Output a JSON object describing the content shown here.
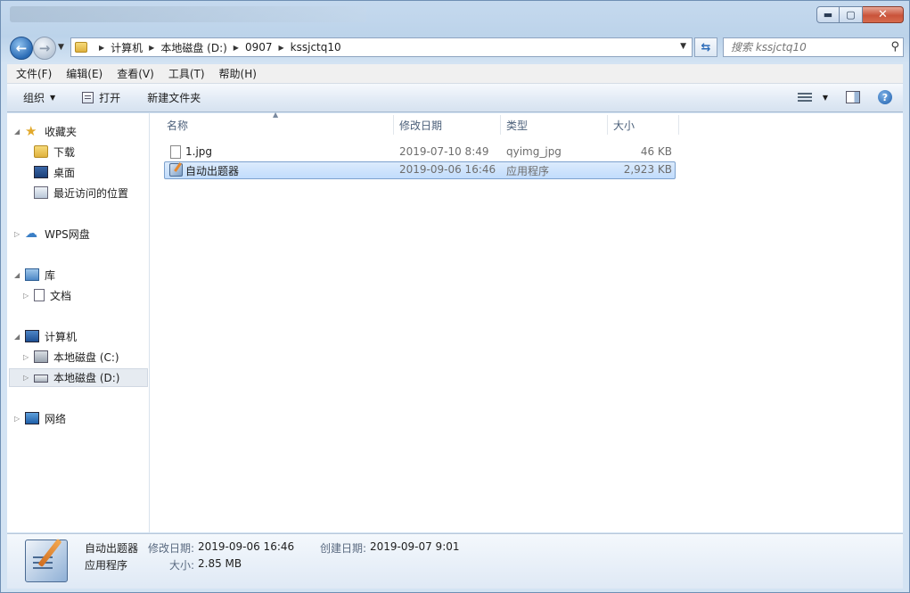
{
  "window": {
    "controls": {
      "minimize": "▬",
      "maximize": "▢",
      "close": "✕"
    }
  },
  "address": {
    "breadcrumbs": [
      "计算机",
      "本地磁盘 (D:)",
      "0907",
      "kssjctq10"
    ]
  },
  "search": {
    "placeholder": "搜索 kssjctq10"
  },
  "menubar": [
    "文件(F)",
    "编辑(E)",
    "查看(V)",
    "工具(T)",
    "帮助(H)"
  ],
  "toolbar": {
    "organize": "组织",
    "open": "打开",
    "new_folder": "新建文件夹",
    "help": "?"
  },
  "navpane": {
    "favorites": "收藏夹",
    "downloads": "下载",
    "desktop": "桌面",
    "recent": "最近访问的位置",
    "wps": "WPS网盘",
    "library": "库",
    "documents": "文档",
    "computer": "计算机",
    "drive_c": "本地磁盘 (C:)",
    "drive_d": "本地磁盘 (D:)",
    "network": "网络"
  },
  "columns": {
    "name": "名称",
    "modified": "修改日期",
    "type": "类型",
    "size": "大小"
  },
  "files": [
    {
      "name": "1.jpg",
      "modified": "2019-07-10 8:49",
      "type": "qyimg_jpg",
      "size": "46 KB"
    },
    {
      "name": "自动出题器",
      "modified": "2019-09-06 16:46",
      "type": "应用程序",
      "size": "2,923 KB"
    }
  ],
  "details": {
    "name": "自动出题器",
    "type": "应用程序",
    "modified_label": "修改日期:",
    "modified_value": "2019-09-06 16:46",
    "created_label": "创建日期:",
    "created_value": "2019-09-07 9:01",
    "size_label": "大小:",
    "size_value": "2.85 MB"
  },
  "colors": {
    "selection": "#cce4fc",
    "chrome": "#c5d9ee",
    "close": "#c9533a"
  }
}
